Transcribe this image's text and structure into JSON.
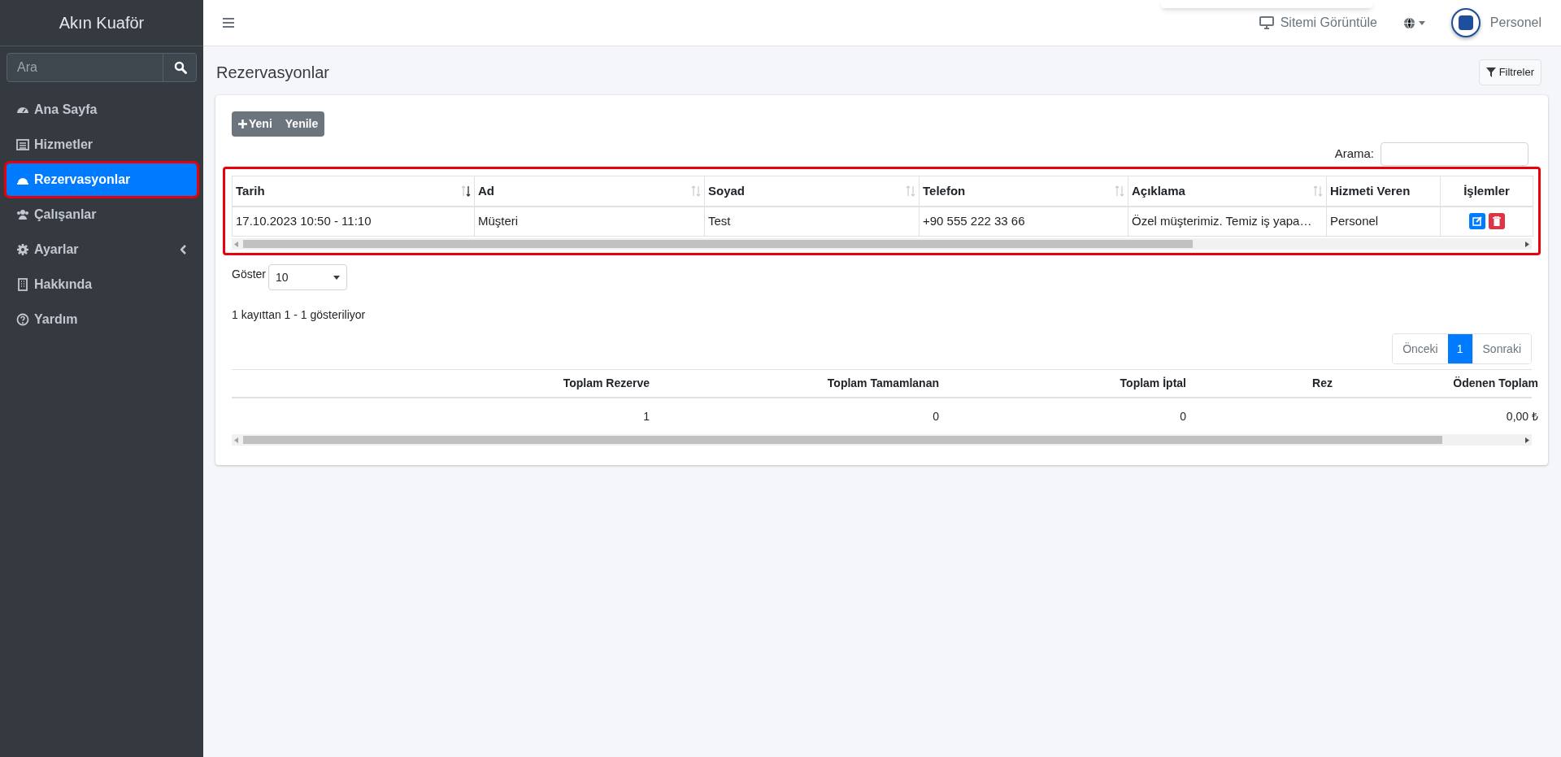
{
  "sidebar": {
    "brand": "Akın Kuaför",
    "search": {
      "placeholder": "Ara"
    },
    "items": [
      {
        "label": "Ana Sayfa",
        "selected": false,
        "has_submenu": false
      },
      {
        "label": "Hizmetler",
        "selected": false,
        "has_submenu": false
      },
      {
        "label": "Rezervasyonlar",
        "selected": true,
        "has_submenu": false
      },
      {
        "label": "Çalışanlar",
        "selected": false,
        "has_submenu": false
      },
      {
        "label": "Ayarlar",
        "selected": false,
        "has_submenu": true
      },
      {
        "label": "Hakkında",
        "selected": false,
        "has_submenu": false
      },
      {
        "label": "Yardım",
        "selected": false,
        "has_submenu": false
      }
    ]
  },
  "topbar": {
    "view_site": "Sitemi Görüntüle",
    "user": "Personel"
  },
  "page": {
    "title": "Rezervasyonlar",
    "filter_button": "Filtreler"
  },
  "toolbar": {
    "buttons": [
      "Yeni",
      "Yenile"
    ],
    "search_label": "Arama:"
  },
  "table": {
    "columns": [
      {
        "label": "Tarih",
        "sortable": true,
        "sorted": true
      },
      {
        "label": "Ad",
        "sortable": true,
        "sorted": false
      },
      {
        "label": "Soyad",
        "sortable": true,
        "sorted": false
      },
      {
        "label": "Telefon",
        "sortable": true,
        "sorted": false
      },
      {
        "label": "Açıklama",
        "sortable": true,
        "sorted": false
      },
      {
        "label": "Hizmeti Veren",
        "sortable": false
      },
      {
        "label": "İşlemler",
        "sortable": false
      }
    ],
    "rows": [
      {
        "cells": [
          "17.10.2023 10:50 - 11:10",
          "Müşteri",
          "Test",
          "+90 555 222 33 66",
          "Özel müşterimiz. Temiz iş yapa…",
          "Personel"
        ]
      }
    ]
  },
  "length": {
    "label": "Göster",
    "value": "10"
  },
  "info": "1 kayıttan 1 - 1 gösteriliyor",
  "pagination": [
    {
      "label": "Önceki",
      "selected": false
    },
    {
      "label": "1",
      "selected": true
    },
    {
      "label": "Sonraki",
      "selected": false
    }
  ],
  "summary": {
    "columns": [
      {
        "label": "Toplam Rezerve",
        "value": "1"
      },
      {
        "label": "Toplam Tamamlanan",
        "value": "0"
      },
      {
        "label": "Toplam İptal",
        "value": "0"
      },
      {
        "label": "Rez"
      },
      {
        "label": "Ödenen Toplam",
        "value": "0,00 ₺"
      }
    ]
  }
}
